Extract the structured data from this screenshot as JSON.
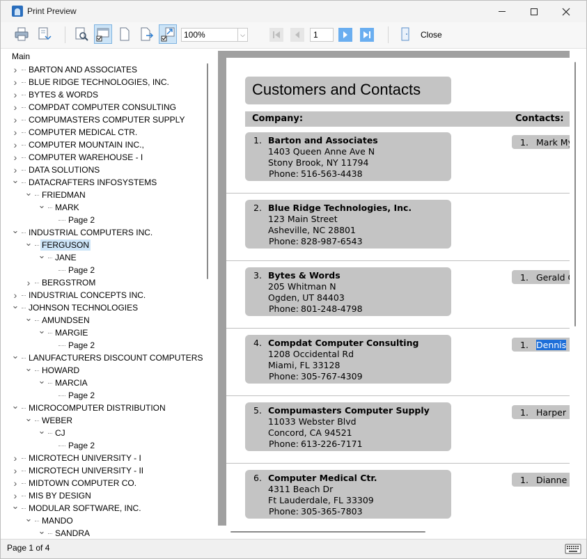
{
  "window": {
    "title": "Print Preview"
  },
  "toolbar": {
    "zoom_value": "100%",
    "page_value": "1",
    "close_label": "Close"
  },
  "tree": {
    "root": "Main",
    "nodes": [
      "BARTON AND ASSOCIATES",
      "BLUE RIDGE TECHNOLOGIES, INC.",
      "BYTES & WORDS",
      "COMPDAT COMPUTER CONSULTING",
      "COMPUMASTERS COMPUTER SUPPLY",
      "COMPUTER MEDICAL CTR.",
      "COMPUTER MOUNTAIN INC.,",
      "COMPUTER WAREHOUSE - I",
      "DATA SOLUTIONS",
      "DATACRAFTERS INFOSYSTEMS",
      "FRIEDMAN",
      "MARK",
      "Page 2",
      "INDUSTRIAL COMPUTERS INC.",
      "FERGUSON",
      "JANE",
      "Page 2",
      "BERGSTROM",
      "INDUSTRIAL CONCEPTS INC.",
      "JOHNSON TECHNOLOGIES",
      "AMUNDSEN",
      "MARGIE",
      "Page 2",
      "LANUFACTURERS DISCOUNT COMPUTERS",
      "HOWARD",
      "MARCIA",
      "Page 2",
      "MICROCOMPUTER DISTRIBUTION",
      "WEBER",
      "CJ",
      "Page 2",
      "MICROTECH UNIVERSITY - I",
      "MICROTECH UNIVERSITY - II",
      "MIDTOWN COMPUTER CO.",
      "MIS BY DESIGN",
      "MODULAR SOFTWARE, INC.",
      "MANDO",
      "SANDRA"
    ]
  },
  "report": {
    "title": "Customers and Contacts",
    "header_company": "Company:",
    "header_contacts": "Contacts:",
    "records": [
      {
        "num": "1.",
        "name": "Barton and Associates",
        "address": "1403 Queen Anne Ave N",
        "city": "Stony Brook, NY 11794",
        "phone_label": "Phone:",
        "phone": "516-563-4438",
        "contact_num": "1.",
        "contact": "Mark My"
      },
      {
        "num": "2.",
        "name": "Blue Ridge Technologies, Inc.",
        "address": "123 Main Street",
        "city": "Asheville, NC 28801",
        "phone_label": "Phone:",
        "phone": "828-987-6543",
        "contact_num": "",
        "contact": ""
      },
      {
        "num": "3.",
        "name": "Bytes & Words",
        "address": "205 Whitman N",
        "city": "Ogden, UT 84403",
        "phone_label": "Phone:",
        "phone": "801-248-4798",
        "contact_num": "1.",
        "contact": "Gerald G"
      },
      {
        "num": "4.",
        "name": "Compdat Computer Consulting",
        "address": "1208 Occidental Rd",
        "city": "Miami, FL 33128",
        "phone_label": "Phone:",
        "phone": "305-767-4309",
        "contact_num": "1.",
        "contact": "Dennis"
      },
      {
        "num": "5.",
        "name": "Compumasters Computer Supply",
        "address": "11033 Webster Blvd",
        "city": "Concord, CA 94521",
        "phone_label": "Phone:",
        "phone": "613-226-7171",
        "contact_num": "1.",
        "contact": "Harper"
      },
      {
        "num": "6.",
        "name": "Computer Medical Ctr.",
        "address": "4311 Beach Dr",
        "city": "Ft Lauderdale, FL 33309",
        "phone_label": "Phone:",
        "phone": "305-365-7803",
        "contact_num": "1.",
        "contact": "Dianne"
      }
    ]
  },
  "status": {
    "page_text": "Page 1 of 4"
  },
  "colors": {
    "selection": "#cce4f7",
    "highlight": "#1e6fd9",
    "band": "#c4c4c4",
    "nav_active": "#6aaef0"
  }
}
